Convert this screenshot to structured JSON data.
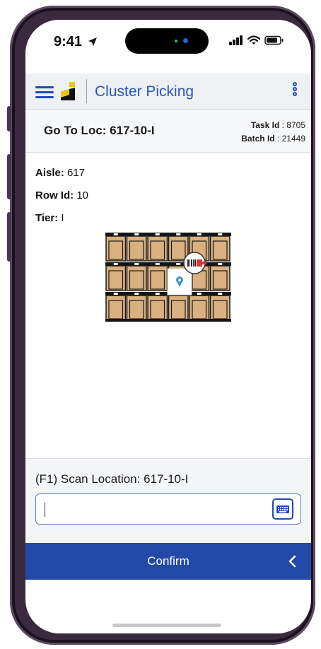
{
  "status_bar": {
    "time": "9:41"
  },
  "app_bar": {
    "title": "Cluster Picking"
  },
  "task": {
    "go_to": "Go To Loc: 617-10-I",
    "task_id_label": "Task Id",
    "task_id_value": ": 8705",
    "batch_id_label": "Batch Id",
    "batch_id_value": ": 21449"
  },
  "location": {
    "aisle_label": "Aisle:",
    "aisle_value": " 617",
    "row_label": "Row Id:",
    "row_value": " 10",
    "tier_label": "Tier:",
    "tier_value": " I"
  },
  "scan": {
    "label": "(F1) Scan Location: 617-10-I",
    "value": "",
    "placeholder": ""
  },
  "footer": {
    "confirm_label": "Confirm"
  },
  "colors": {
    "brand_blue": "#2349a6",
    "accent_blue": "#2856b7",
    "logo_yellow": "#e8c511",
    "logo_black": "#111111",
    "pin_blue": "#3c95d3"
  },
  "icons": [
    "menu-icon",
    "app-logo",
    "more-vertical-icon",
    "keyboard-icon",
    "chevron-left-icon",
    "location-pin-icon",
    "barcode-icon",
    "signal-icon",
    "wifi-icon",
    "battery-icon",
    "location-arrow-icon"
  ]
}
